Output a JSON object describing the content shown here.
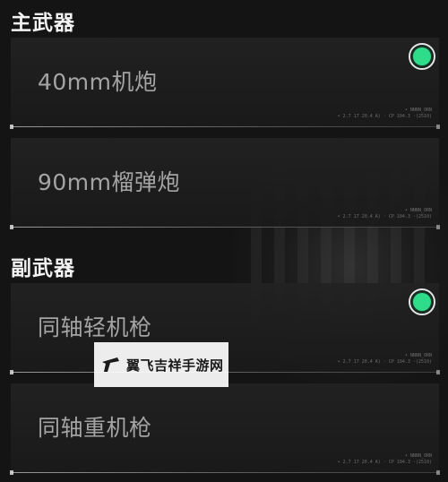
{
  "sections": {
    "primary": {
      "title": "主武器",
      "items": [
        {
          "label": "40mm机炮",
          "selected": true,
          "code": "• NNNN_ORN\n• 2.7 17 20.4 A) · CP 104.3 ·(2510)"
        },
        {
          "label": "90mm榴弹炮",
          "selected": false,
          "code": "• NNNN_ORN\n• 2.7 17 20.4 A) · CP 104.3 ·(2510)"
        }
      ]
    },
    "secondary": {
      "title": "副武器",
      "items": [
        {
          "label": "同轴轻机枪",
          "selected": true,
          "code": "• NNNN_ORN\n• 2.7 17 20.4 A) · CP 104.3 ·(2510)"
        },
        {
          "label": "同轴重机枪",
          "selected": false,
          "code": "• NNNN_ORN\n• 2.7 17 20.4 A) · CP 104.3 ·(2510)"
        }
      ]
    }
  },
  "watermark": {
    "text": "翼飞吉祥手游网"
  },
  "colors": {
    "accent": "#2fdc8a",
    "background": "#141414"
  }
}
